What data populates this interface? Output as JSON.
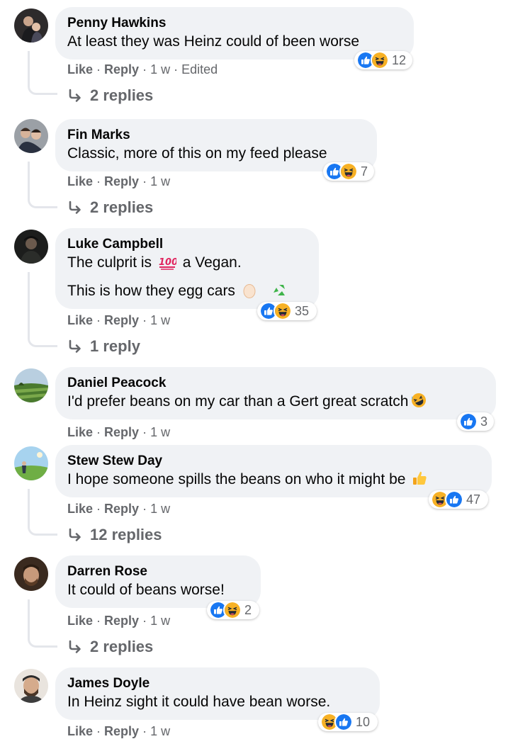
{
  "actions": {
    "like": "Like",
    "reply": "Reply",
    "separator": "·"
  },
  "colors": {
    "bubble": "#f0f2f5",
    "meta": "#65676b",
    "like_blue": "#1877f2",
    "haha_yellow": "#f7b125"
  },
  "comments": [
    {
      "author": "Penny Hawkins",
      "text": "At least they was Heinz could of been worse",
      "time": "1 w",
      "edited": "Edited",
      "reactions": {
        "icons": [
          "like-icon",
          "haha-icon"
        ],
        "count": "12"
      },
      "replies": "2 replies"
    },
    {
      "author": "Fin Marks",
      "text": "Classic, more of this on my feed please",
      "time": "1 w",
      "reactions": {
        "icons": [
          "like-icon",
          "haha-icon"
        ],
        "count": "7"
      },
      "replies": "2 replies"
    },
    {
      "author": "Luke Campbell",
      "text_before_emoji": "The culprit is",
      "text_after_emoji": "a Vegan.",
      "text_line2": "This is how they egg cars",
      "emojis": [
        "hundred-points-emoji",
        "egg-emoji",
        "recycle-emoji"
      ],
      "time": "1 w",
      "reactions": {
        "icons": [
          "like-icon",
          "haha-icon"
        ],
        "count": "35"
      },
      "replies": "1 reply"
    },
    {
      "author": "Daniel Peacock",
      "text": "I'd prefer beans on my car than a Gert great scratch",
      "emojis": [
        "rolling-laughing-emoji"
      ],
      "time": "1 w",
      "reactions": {
        "icons": [
          "like-icon"
        ],
        "count": "3"
      }
    },
    {
      "author": "Stew Stew Day",
      "text": "I hope someone spills the beans on who it might be",
      "emojis": [
        "thumbs-up-emoji"
      ],
      "time": "1 w",
      "reactions": {
        "icons": [
          "haha-icon",
          "like-icon"
        ],
        "count": "47"
      },
      "replies": "12 replies"
    },
    {
      "author": "Darren Rose",
      "text": "It could of beans worse!",
      "time": "1 w",
      "reactions": {
        "icons": [
          "like-icon",
          "haha-icon"
        ],
        "count": "2"
      },
      "replies": "2 replies"
    },
    {
      "author": "James Doyle",
      "text": "In Heinz sight it could have bean worse.",
      "time": "1 w",
      "reactions": {
        "icons": [
          "haha-icon",
          "like-icon"
        ],
        "count": "10"
      }
    }
  ]
}
